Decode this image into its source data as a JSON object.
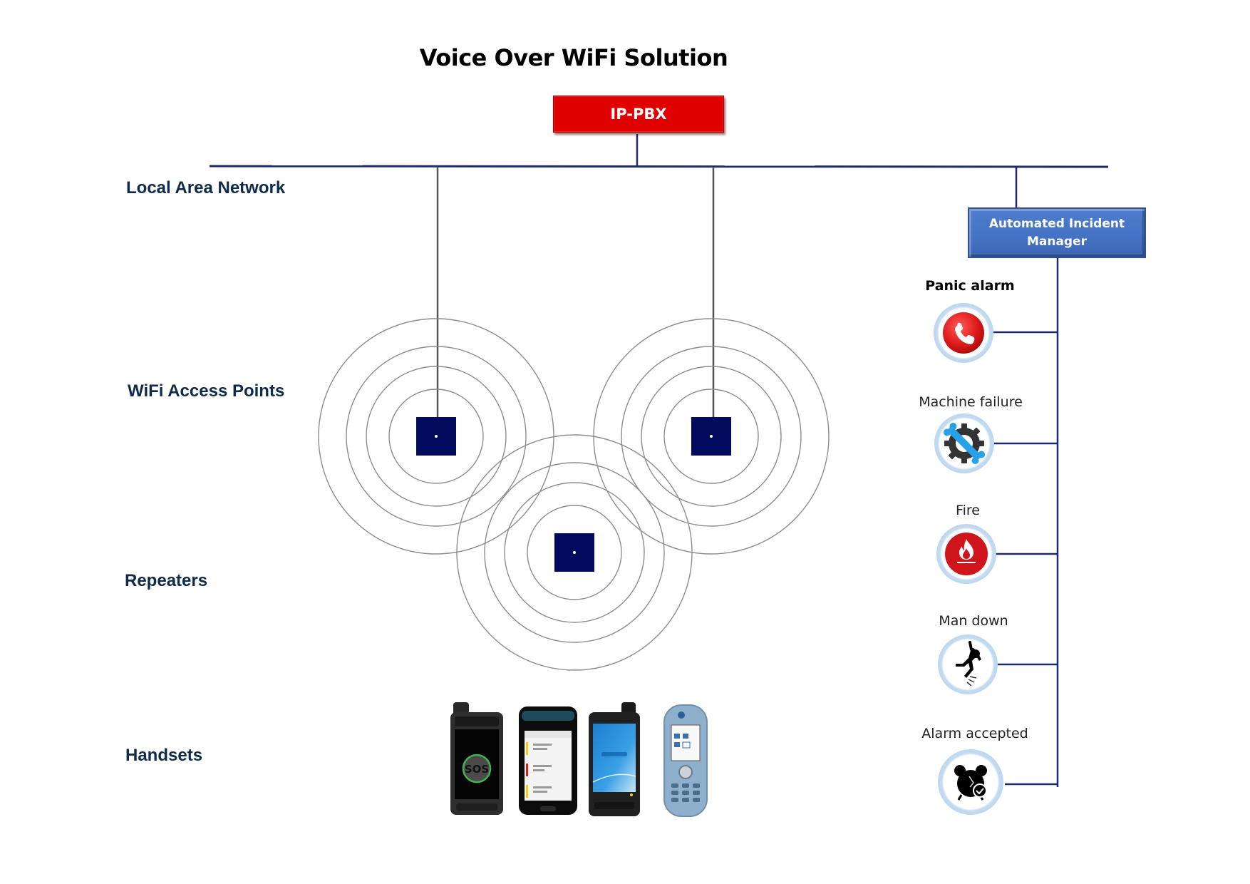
{
  "title": "Voice Over WiFi Solution",
  "ip_pbx": {
    "label": "IP-PBX"
  },
  "incident_manager": {
    "label_line1": "Automated Incident",
    "label_line2": "Manager"
  },
  "layers": [
    {
      "id": "lan",
      "label": "Local Area Network"
    },
    {
      "id": "ap",
      "label": "WiFi Access Points"
    },
    {
      "id": "repeaters",
      "label": "Repeaters"
    },
    {
      "id": "handsets",
      "label": "Handsets"
    }
  ],
  "access_points": [
    {
      "id": "ap-1",
      "kind": "access-point"
    },
    {
      "id": "ap-2",
      "kind": "access-point"
    },
    {
      "id": "repeater-1",
      "kind": "repeater"
    }
  ],
  "events": [
    {
      "label": "Panic alarm",
      "icon": "phone-icon",
      "bold": true
    },
    {
      "label": "Machine failure",
      "icon": "gear-wrench-icon",
      "bold": false
    },
    {
      "label": "Fire",
      "icon": "fire-icon",
      "bold": false
    },
    {
      "label": "Man down",
      "icon": "falling-person-icon",
      "bold": false
    },
    {
      "label": "Alarm accepted",
      "icon": "alarm-clock-check-icon",
      "bold": false
    }
  ],
  "handsets": [
    {
      "name": "rugged-sos-phone",
      "screen_text": "SOS"
    },
    {
      "name": "alert-list-phone",
      "screen_text": ""
    },
    {
      "name": "rugged-smartphone",
      "screen_text": ""
    },
    {
      "name": "dect-handset",
      "screen_text": ""
    }
  ],
  "colors": {
    "pbx_red": "#e00000",
    "aim_blue": "#4472c4",
    "line_navy": "#1f2a6b",
    "ap_square": "#020a5e",
    "ring_gray": "#8c8c8c",
    "label_navy": "#0f2a4a"
  }
}
